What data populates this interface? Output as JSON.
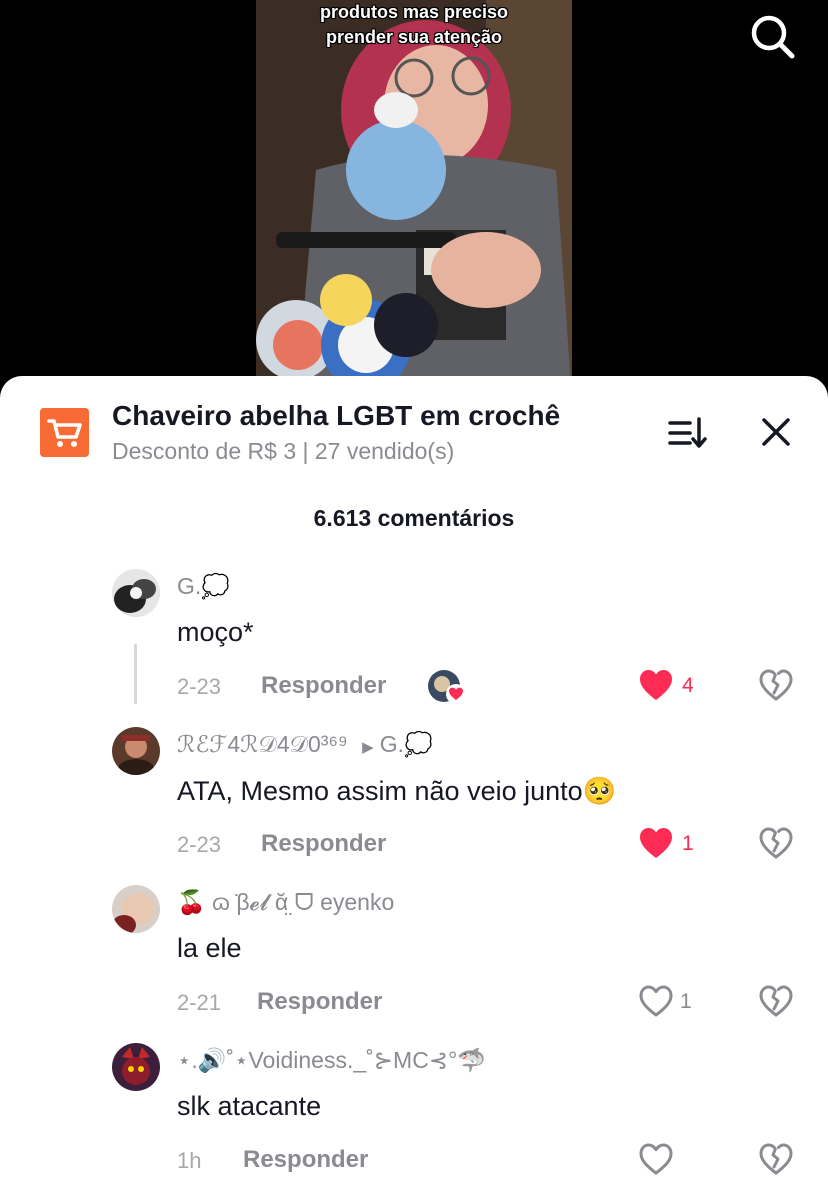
{
  "video": {
    "caption_lines": [
      "produtos mas preciso",
      "prender sua atenção"
    ],
    "search_icon": "search-icon"
  },
  "product": {
    "title": "Chaveiro abelha LGBT em crochê",
    "subtitle": "Desconto de R$ 3 | 27 vendido(s)",
    "cart_icon": "shopping-cart-icon",
    "cart_color": "#f86b34"
  },
  "comments_header": {
    "count_label": "6.613 comentários"
  },
  "reply_label": "Responder",
  "colors": {
    "like_red": "#fe2c55",
    "muted": "#8a8b91"
  },
  "comments": [
    {
      "username": "G.💭",
      "text": "moço*",
      "date": "2-23",
      "likes": "4",
      "liked": true,
      "creator_liked": true
    },
    {
      "username": "ℛℰℱ4ℛ𝒟4𝒟0³⁶⁹",
      "reply_to": "G.💭",
      "text": "ATA, Mesmo assim não veio junto🥺",
      "date": "2-23",
      "likes": "1",
      "liked": true
    },
    {
      "username": "🍒 ɷ ̇β𝓮𝓵 ᾰ̤ ᗜ eyenko",
      "text": "la ele",
      "date": "2-21",
      "likes": "1",
      "liked": false
    },
    {
      "username": "⋆.🔊˚⋆Voidiness._˚⊱MC⊰°🦈",
      "text": "slk atacante",
      "date": "1h",
      "likes": "",
      "liked": false
    }
  ]
}
